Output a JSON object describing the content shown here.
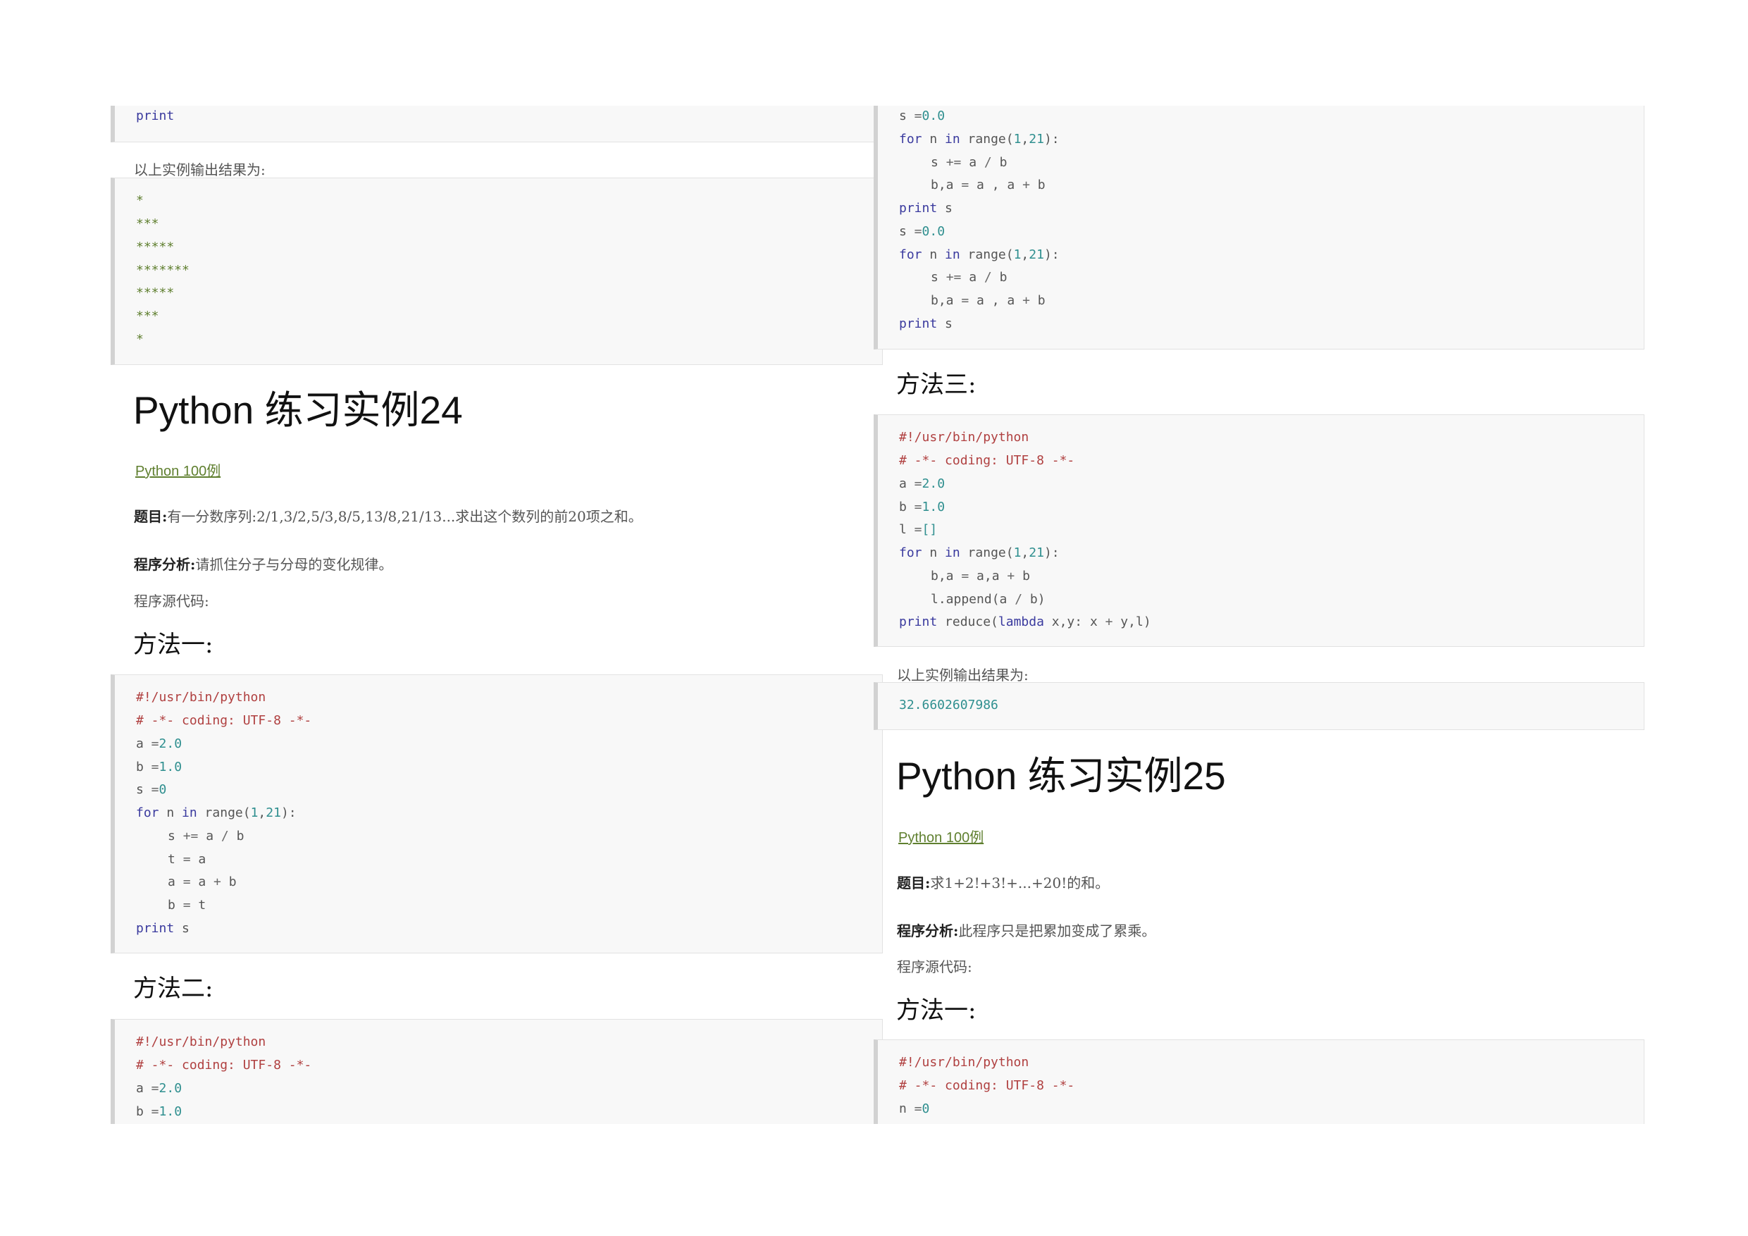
{
  "left": {
    "code_print_top": {
      "line1": "print"
    },
    "output_label": "以上实例输出结果为:",
    "star_output": [
      "*",
      "***",
      "*****",
      "*******",
      "*****",
      "***",
      "*"
    ],
    "title": "Python 练习实例24",
    "link": "Python 100例",
    "problem_label": "题目:",
    "problem_text": "有一分数序列:2/1,3/2,5/3,8/5,13/8,21/13...求出这个数列的前20项之和。",
    "analysis_label": "程序分析:",
    "analysis_text": "请抓住分子与分母的变化规律。",
    "source_label": "程序源代码:",
    "method1": "方法一:",
    "method2": "方法二:",
    "code1": {
      "shebang": "#!/usr/bin/python",
      "coding": "# -*- coding: UTF-8 -*-",
      "a_var": "a",
      "a_op": " =",
      "a_val": "2.0",
      "b_var": "b",
      "b_op": " =",
      "b_val": "1.0",
      "s_var": "s",
      "s_op": " =",
      "s_val": "0",
      "for_kw": "for",
      "for_mid1": " n ",
      "in_kw": "in",
      "for_mid2": " range(",
      "r1": "1",
      "comma": ",",
      "r2": "21",
      "for_end": "):",
      "l1a": "s ",
      "l1op": "+=",
      "l1b": " a ",
      "l1div": "/",
      "l1c": " b",
      "l2a": "t ",
      "l2op": "=",
      "l2b": " a",
      "l3a": "a ",
      "l3op": "=",
      "l3b": " a ",
      "l3plus": "+",
      "l3c": " b",
      "l4a": "b ",
      "l4op": "=",
      "l4b": " t",
      "print_kw": "print",
      "print_arg": " s"
    },
    "code2": {
      "shebang": "#!/usr/bin/python",
      "coding": "# -*- coding: UTF-8 -*-",
      "a_var": "a",
      "a_op": " =",
      "a_val": "2.0",
      "b_var": "b",
      "b_op": " =",
      "b_val": "1.0"
    }
  },
  "right": {
    "code_top": {
      "s_var": "s",
      "s_op": " =",
      "s_val": "0.0",
      "for_kw": "for",
      "for_mid1": " n ",
      "in_kw": "in",
      "for_mid2": " range(",
      "r1": "1",
      "comma": ",",
      "r2": "21",
      "for_end": "):",
      "l1a": "s ",
      "l1op": "+=",
      "l1b": " a ",
      "l1div": "/",
      "l1c": " b",
      "l2a": "b,a ",
      "l2op": "=",
      "l2b": " a , a ",
      "l2plus": "+",
      "l2c": " b",
      "print_kw": "print",
      "print_arg": " s"
    },
    "method3": "方法三:",
    "code3": {
      "shebang": "#!/usr/bin/python",
      "coding": "# -*- coding: UTF-8 -*-",
      "a_var": "a",
      "a_op": " =",
      "a_val": "2.0",
      "b_var": "b",
      "b_op": " =",
      "b_val": "1.0",
      "l_var": "l",
      "l_op": " =",
      "l_val": "[]",
      "for_kw": "for",
      "for_mid1": " n ",
      "in_kw": "in",
      "for_mid2": " range(",
      "r1": "1",
      "comma": ",",
      "r2": "21",
      "for_end": "):",
      "l1a": "b,a ",
      "l1op": "=",
      "l1b": " a,a ",
      "l1plus": "+",
      "l1c": " b",
      "l2a": "l.append(a ",
      "l2div": "/",
      "l2b": " b)",
      "print_kw": "print",
      "p_mid": " reduce(",
      "lambda_kw": "lambda",
      "p_mid2": " x,y: x ",
      "p_plus": "+",
      "p_end": " y,l)"
    },
    "output_label": "以上实例输出结果为:",
    "output_value": "32.6602607986",
    "title": "Python 练习实例25",
    "link": "Python 100例",
    "problem_label": "题目:",
    "problem_text": "求1+2!+3!+...+20!的和。",
    "analysis_label": "程序分析:",
    "analysis_text": "此程序只是把累加变成了累乘。",
    "source_label": "程序源代码:",
    "method1": "方法一:",
    "code4": {
      "shebang": "#!/usr/bin/python",
      "coding": "# -*- coding: UTF-8 -*-",
      "n_var": "n",
      "n_op": " =",
      "n_val": "0"
    }
  }
}
